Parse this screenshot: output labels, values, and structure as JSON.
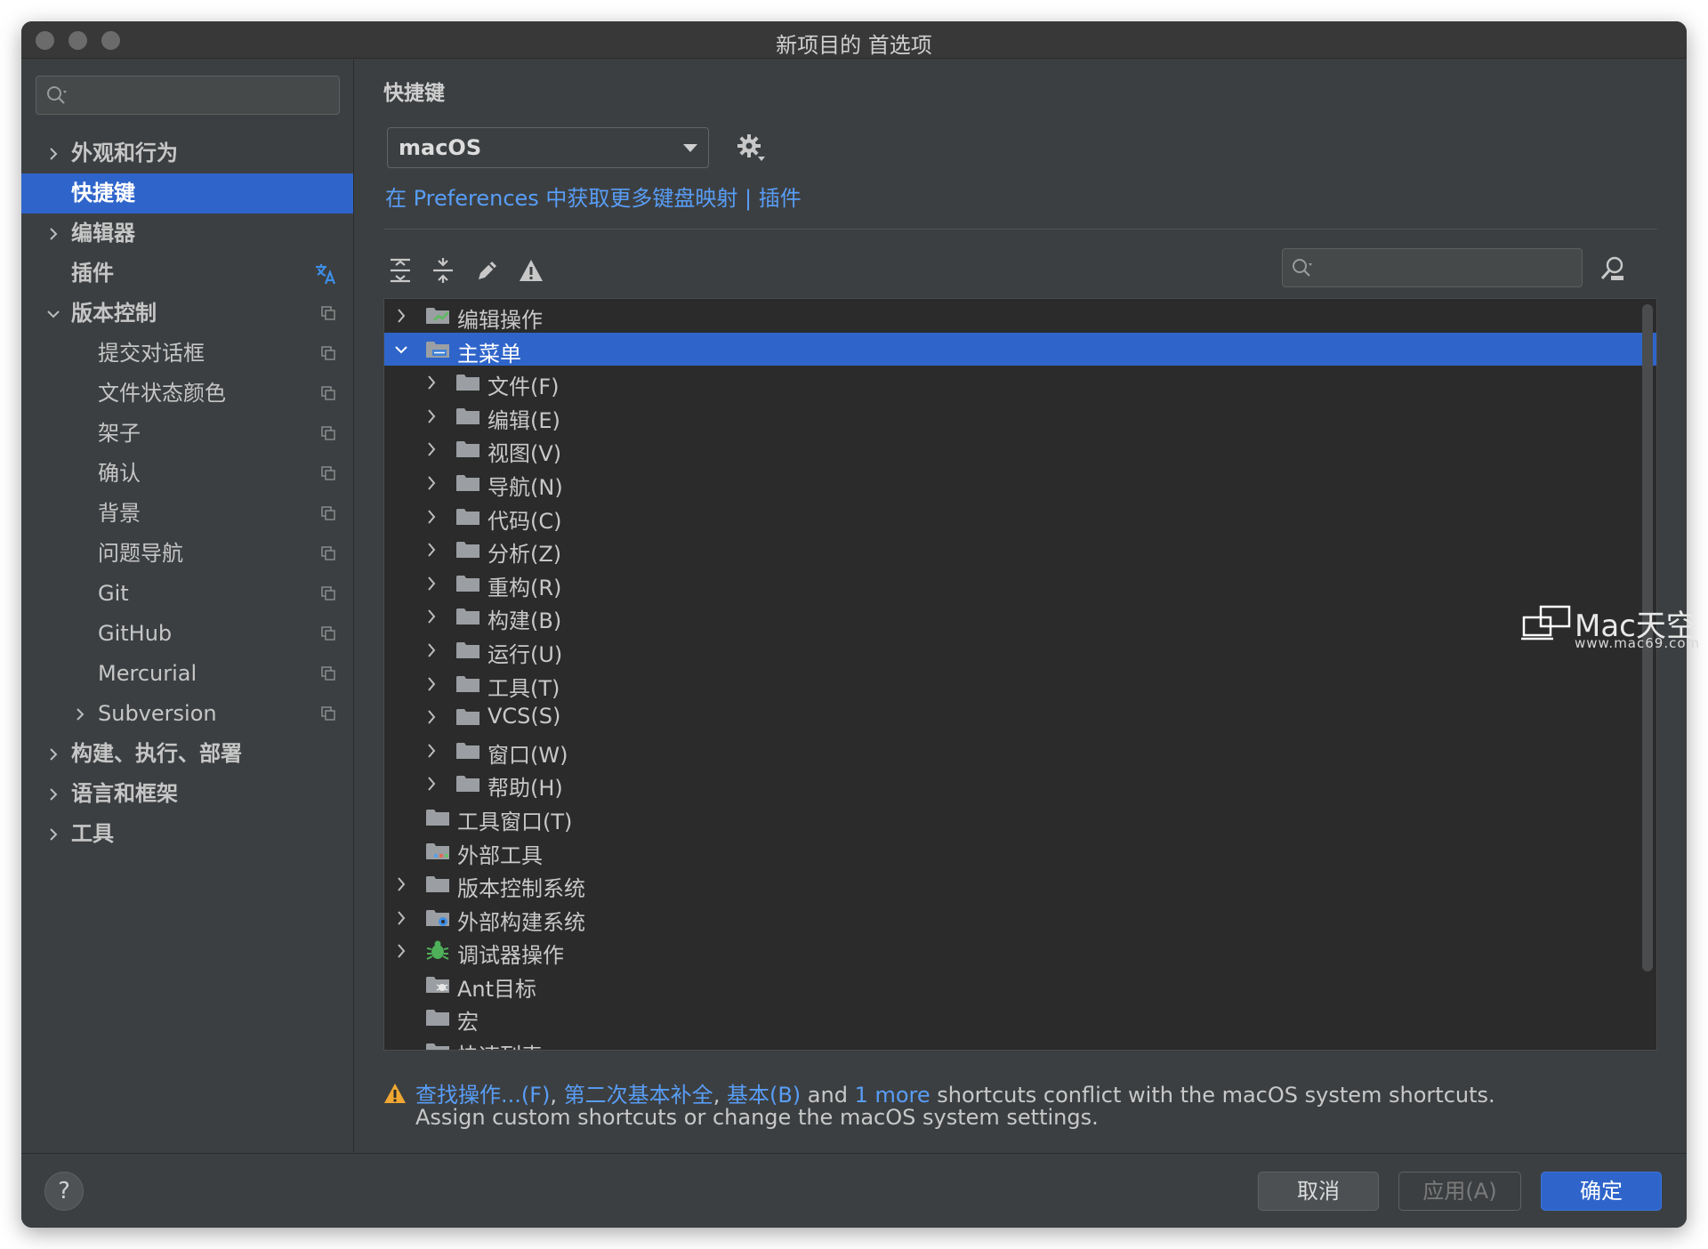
{
  "window": {
    "title": "新项目的 首选项"
  },
  "sidebar": {
    "search": {
      "placeholder": ""
    },
    "items": [
      {
        "label": "外观和行为",
        "expandable": true,
        "expanded": false,
        "level": 0,
        "bold": true
      },
      {
        "label": "快捷键",
        "expandable": false,
        "level": 0,
        "bold": true,
        "active": true
      },
      {
        "label": "编辑器",
        "expandable": true,
        "expanded": false,
        "level": 0,
        "bold": true
      },
      {
        "label": "插件",
        "expandable": false,
        "level": 0,
        "bold": true,
        "icon": "translate-icon"
      },
      {
        "label": "版本控制",
        "expandable": true,
        "expanded": true,
        "level": 0,
        "bold": true,
        "icon": "copy-icon"
      },
      {
        "label": "提交对话框",
        "level": 1,
        "icon": "copy-icon"
      },
      {
        "label": "文件状态颜色",
        "level": 1,
        "icon": "copy-icon"
      },
      {
        "label": "架子",
        "level": 1,
        "icon": "copy-icon"
      },
      {
        "label": "确认",
        "level": 1,
        "icon": "copy-icon"
      },
      {
        "label": "背景",
        "level": 1,
        "icon": "copy-icon"
      },
      {
        "label": "问题导航",
        "level": 1,
        "icon": "copy-icon"
      },
      {
        "label": "Git",
        "level": 1,
        "icon": "copy-icon"
      },
      {
        "label": "GitHub",
        "level": 1,
        "icon": "copy-icon"
      },
      {
        "label": "Mercurial",
        "level": 1,
        "icon": "copy-icon"
      },
      {
        "label": "Subversion",
        "level": 1,
        "expandable": true,
        "expanded": false,
        "icon": "copy-icon"
      },
      {
        "label": "构建、执行、部署",
        "expandable": true,
        "expanded": false,
        "level": 0,
        "bold": true
      },
      {
        "label": "语言和框架",
        "expandable": true,
        "expanded": false,
        "level": 0,
        "bold": true
      },
      {
        "label": "工具",
        "expandable": true,
        "expanded": false,
        "level": 0,
        "bold": true
      }
    ]
  },
  "main": {
    "title": "快捷键",
    "keymap": {
      "selected": "macOS"
    },
    "link_text": "在 Preferences 中获取更多键盘映射 | 插件",
    "toolbar": [
      {
        "name": "expand-all-icon"
      },
      {
        "name": "collapse-all-icon"
      },
      {
        "name": "edit-icon"
      },
      {
        "name": "warning-filter-icon"
      }
    ],
    "tree_search": {
      "placeholder": ""
    },
    "tree": [
      {
        "label": "编辑操作",
        "level": 0,
        "expandable": true,
        "expanded": false,
        "icon": "editor-actions-icon"
      },
      {
        "label": "主菜单",
        "level": 0,
        "expandable": true,
        "expanded": true,
        "selected": true,
        "icon": "main-menu-icon"
      },
      {
        "label": "文件(F)",
        "level": 1,
        "expandable": true,
        "icon": "folder-icon"
      },
      {
        "label": "编辑(E)",
        "level": 1,
        "expandable": true,
        "icon": "folder-icon"
      },
      {
        "label": "视图(V)",
        "level": 1,
        "expandable": true,
        "icon": "folder-icon"
      },
      {
        "label": "导航(N)",
        "level": 1,
        "expandable": true,
        "icon": "folder-icon"
      },
      {
        "label": "代码(C)",
        "level": 1,
        "expandable": true,
        "icon": "folder-icon"
      },
      {
        "label": "分析(Z)",
        "level": 1,
        "expandable": true,
        "icon": "folder-icon"
      },
      {
        "label": "重构(R)",
        "level": 1,
        "expandable": true,
        "icon": "folder-icon"
      },
      {
        "label": "构建(B)",
        "level": 1,
        "expandable": true,
        "icon": "folder-icon"
      },
      {
        "label": "运行(U)",
        "level": 1,
        "expandable": true,
        "icon": "folder-icon"
      },
      {
        "label": "工具(T)",
        "level": 1,
        "expandable": true,
        "icon": "folder-icon"
      },
      {
        "label": "VCS(S)",
        "level": 1,
        "expandable": true,
        "icon": "folder-icon"
      },
      {
        "label": "窗口(W)",
        "level": 1,
        "expandable": true,
        "icon": "folder-icon"
      },
      {
        "label": "帮助(H)",
        "level": 1,
        "expandable": true,
        "icon": "folder-icon"
      },
      {
        "label": "工具窗口(T)",
        "level": 0,
        "expandable": false,
        "icon": "folder-icon"
      },
      {
        "label": "外部工具",
        "level": 0,
        "expandable": false,
        "icon": "external-tools-icon"
      },
      {
        "label": "版本控制系统",
        "level": 0,
        "expandable": true,
        "icon": "folder-icon"
      },
      {
        "label": "外部构建系统",
        "level": 0,
        "expandable": true,
        "icon": "external-build-icon"
      },
      {
        "label": "调试器操作",
        "level": 0,
        "expandable": true,
        "icon": "debugger-icon"
      },
      {
        "label": "Ant目标",
        "level": 0,
        "expandable": false,
        "icon": "ant-icon"
      },
      {
        "label": "宏",
        "level": 0,
        "expandable": false,
        "icon": "folder-icon"
      },
      {
        "label": "快速列表",
        "level": 0,
        "expandable": false,
        "icon": "folder-icon"
      }
    ],
    "warning": {
      "link1": "查找操作...(F)",
      "sep1": ", ",
      "link2": "第二次基本补全",
      "sep2": ", ",
      "link3": "基本(B)",
      "mid": " and ",
      "link4": "1 more",
      "tail": " shortcuts conflict with the macOS system shortcuts.",
      "line2": "Assign custom shortcuts or change the macOS system settings."
    }
  },
  "footer": {
    "help_label": "?",
    "cancel_label": "取消",
    "apply_label": "应用(A)",
    "ok_label": "确定"
  },
  "watermark": {
    "main": "Mac天空",
    "sub": "www.mac69.com"
  },
  "colors": {
    "accent": "#2f65ca",
    "link": "#589df6",
    "background": "#3c3f41",
    "tree_background": "#2b2b2b"
  }
}
